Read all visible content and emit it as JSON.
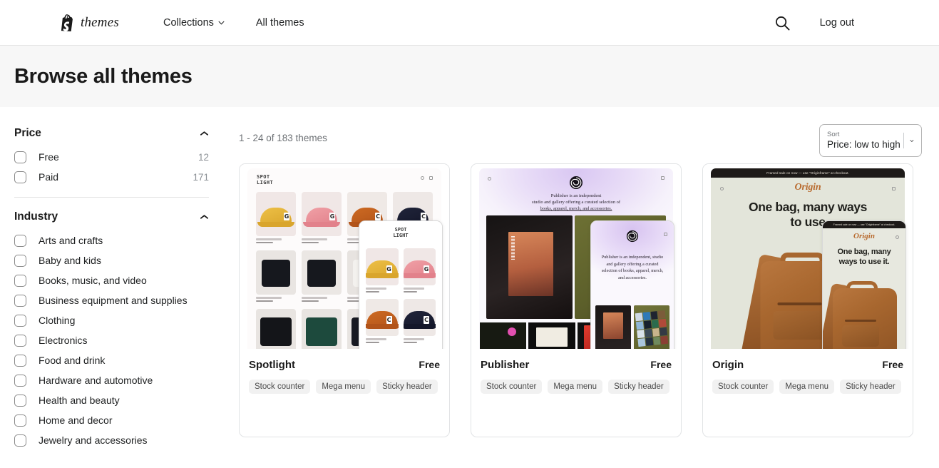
{
  "header": {
    "logo_icon": "shopify-bag-icon",
    "brand": "themes",
    "nav": [
      {
        "label": "Collections",
        "has_chevron": true
      },
      {
        "label": "All themes",
        "has_chevron": false
      }
    ],
    "search_icon": "search-icon",
    "logout": "Log out"
  },
  "hero": {
    "title": "Browse all themes"
  },
  "sidebar": {
    "facets": [
      {
        "title": "Price",
        "collapse_icon": "chevron-up-icon",
        "options": [
          {
            "label": "Free",
            "count": "12",
            "checked": false
          },
          {
            "label": "Paid",
            "count": "171",
            "checked": false
          }
        ]
      },
      {
        "title": "Industry",
        "collapse_icon": "chevron-up-icon",
        "options": [
          {
            "label": "Arts and crafts",
            "count": "",
            "checked": false
          },
          {
            "label": "Baby and kids",
            "count": "",
            "checked": false
          },
          {
            "label": "Books, music, and video",
            "count": "",
            "checked": false
          },
          {
            "label": "Business equipment and supplies",
            "count": "",
            "checked": false
          },
          {
            "label": "Clothing",
            "count": "",
            "checked": false
          },
          {
            "label": "Electronics",
            "count": "",
            "checked": false
          },
          {
            "label": "Food and drink",
            "count": "",
            "checked": false
          },
          {
            "label": "Hardware and automotive",
            "count": "",
            "checked": false
          },
          {
            "label": "Health and beauty",
            "count": "",
            "checked": false
          },
          {
            "label": "Home and decor",
            "count": "",
            "checked": false
          },
          {
            "label": "Jewelry and accessories",
            "count": "",
            "checked": false
          }
        ]
      }
    ]
  },
  "main": {
    "result_count": "1 - 24 of 183 themes",
    "sort": {
      "label": "Sort",
      "value": "Price: low to high",
      "chevron_icon": "chevron-down-icon"
    },
    "themes": [
      {
        "name": "Spotlight",
        "price": "Free",
        "tags": [
          "Stock counter",
          "Mega menu",
          "Sticky header"
        ],
        "preview": {
          "store_logo": "SPOT\nLIGHT",
          "logo_line1": "SPOT",
          "logo_line2": "LIGHT"
        }
      },
      {
        "name": "Publisher",
        "price": "Free",
        "tags": [
          "Stock counter",
          "Mega menu",
          "Sticky header"
        ],
        "preview": {
          "tagline_line1": "Publisher is an independent",
          "tagline_line2": "studio and gallery offering a curated selection of",
          "tagline_line3": "books, apparel, merch, and accessories.",
          "mobile_tagline": "Publisher is an independent, studio and gallery offering a curated selection of books, apparel, merch, and accessories."
        }
      },
      {
        "name": "Origin",
        "price": "Free",
        "tags": [
          "Stock counter",
          "Mega menu",
          "Sticky header"
        ],
        "preview": {
          "announcement": "Framed sale on now — use \"Originframe\" at checkout.",
          "store_logo": "Origin",
          "headline_line1": "One bag, many ways",
          "headline_line2": "to use",
          "mobile_headline": "One bag, many ways to use it."
        }
      }
    ]
  },
  "colors": {
    "page_bg": "#ffffff",
    "hero_bg": "#f7f7f7",
    "border": "#e3e3e3",
    "text": "#202223",
    "muted": "#6d7175",
    "tag_bg": "#f1f1f1",
    "origin_accent": "#b86a2e",
    "publisher_accent": "#d9c7f2"
  }
}
